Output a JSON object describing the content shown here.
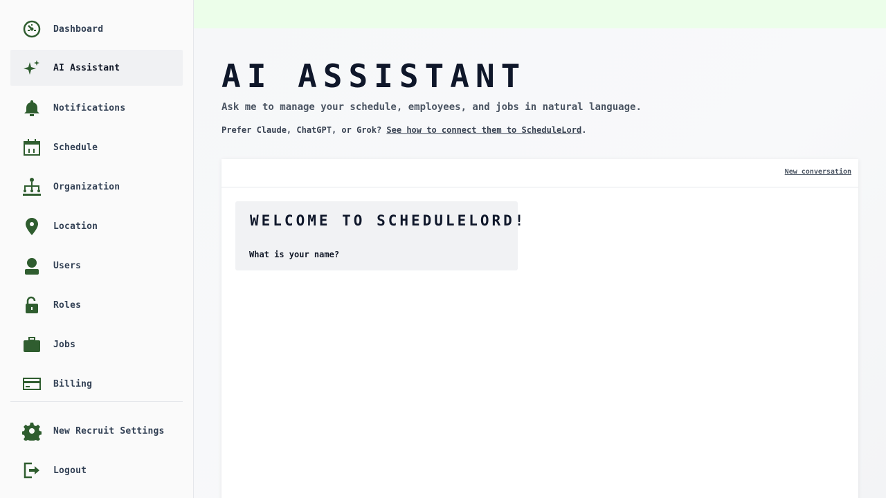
{
  "sidebar": {
    "items": [
      {
        "label": "Dashboard",
        "icon": "dashboard-icon"
      },
      {
        "label": "AI Assistant",
        "icon": "sparkle-icon",
        "active": true
      },
      {
        "label": "Notifications",
        "icon": "bell-icon"
      },
      {
        "label": "Schedule",
        "icon": "calendar-icon"
      },
      {
        "label": "Organization",
        "icon": "org-chart-icon"
      },
      {
        "label": "Location",
        "icon": "location-pin-icon"
      },
      {
        "label": "Users",
        "icon": "user-icon"
      },
      {
        "label": "Roles",
        "icon": "lock-icon"
      },
      {
        "label": "Jobs",
        "icon": "briefcase-icon"
      },
      {
        "label": "Billing",
        "icon": "credit-card-icon"
      }
    ],
    "bottom_items": [
      {
        "label": "New Recruit Settings",
        "icon": "gear-icon"
      },
      {
        "label": "Logout",
        "icon": "logout-icon"
      }
    ]
  },
  "main": {
    "title": "AI Assistant",
    "subtitle": "Ask me to manage your schedule, employees, and jobs in natural language.",
    "prefer_text": "Prefer Claude, ChatGPT, or Grok? ",
    "prefer_link": "See how to connect them to ScheduleLord",
    "prefer_suffix": "."
  },
  "chat": {
    "new_conversation_label": "New conversation",
    "messages": [
      {
        "title": "Welcome to ScheduleLord!",
        "text": "What is your name?"
      }
    ]
  },
  "colors": {
    "icon_green": "#2f5d2f",
    "banner": "#ecfeea",
    "active_bg": "#f0f1f3"
  }
}
